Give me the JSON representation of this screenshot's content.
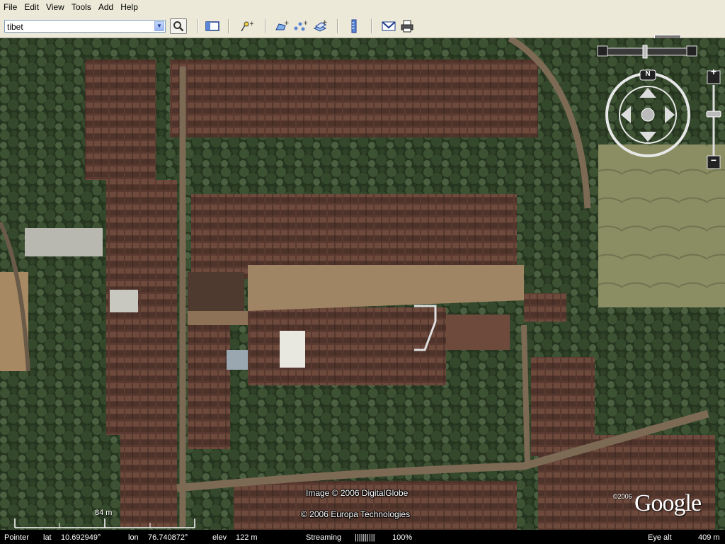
{
  "menu": [
    "File",
    "Edit",
    "View",
    "Tools",
    "Add",
    "Help"
  ],
  "search": {
    "value": "tibet"
  },
  "credits": {
    "image": "Image © 2006 DigitalGlobe",
    "europa": "© 2006 Europa Technologies",
    "year": "©2006",
    "logo": "Google"
  },
  "scale": {
    "label": "84 m"
  },
  "nav": {
    "north": "N"
  },
  "status": {
    "pointer": "Pointer",
    "lat_label": "lat",
    "lat": "10.692949°",
    "lon_label": "lon",
    "lon": "76.740872°",
    "elev_label": "elev",
    "elev": "122 m",
    "streaming_label": "Streaming",
    "streaming_bars": "||||||||||",
    "streaming_pct": "100%",
    "eye_label": "Eye alt",
    "eye": "409 m"
  },
  "colors": {
    "chrome": "#ece9d8",
    "status_bg": "#000000",
    "accent": "#1b3a8b"
  }
}
